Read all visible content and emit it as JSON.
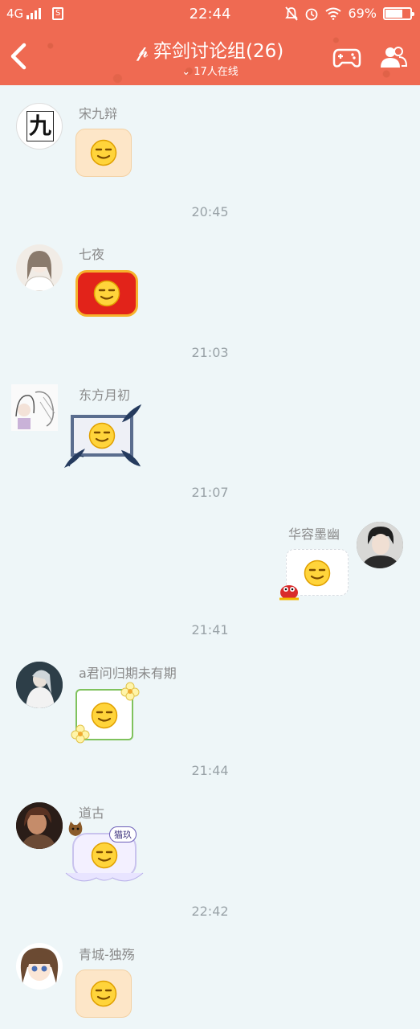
{
  "status_bar": {
    "network": "4G",
    "sim_label": "S",
    "time": "22:44",
    "battery": "69%",
    "battery_level": 0.69
  },
  "header": {
    "title": "弈剑讨论组(26)",
    "online": "17人在线"
  },
  "messages": [
    {
      "sender": "宋九辩",
      "avatar_text": "九",
      "time_after": "20:45"
    },
    {
      "sender": "七夜",
      "time_after": "21:03"
    },
    {
      "sender": "东方月初",
      "time_after": "21:07"
    },
    {
      "sender": "华容墨幽",
      "time_after": "21:41"
    },
    {
      "sender": "a君问归期未有期",
      "time_after": "21:44"
    },
    {
      "sender": "道古",
      "badge": "猫玖",
      "time_after": "22:42"
    },
    {
      "sender": "青城-独殇"
    }
  ],
  "colors": {
    "header_bg": "#ef6a52",
    "chat_bg": "#eef6f8",
    "time_text": "#9aa3a8"
  }
}
